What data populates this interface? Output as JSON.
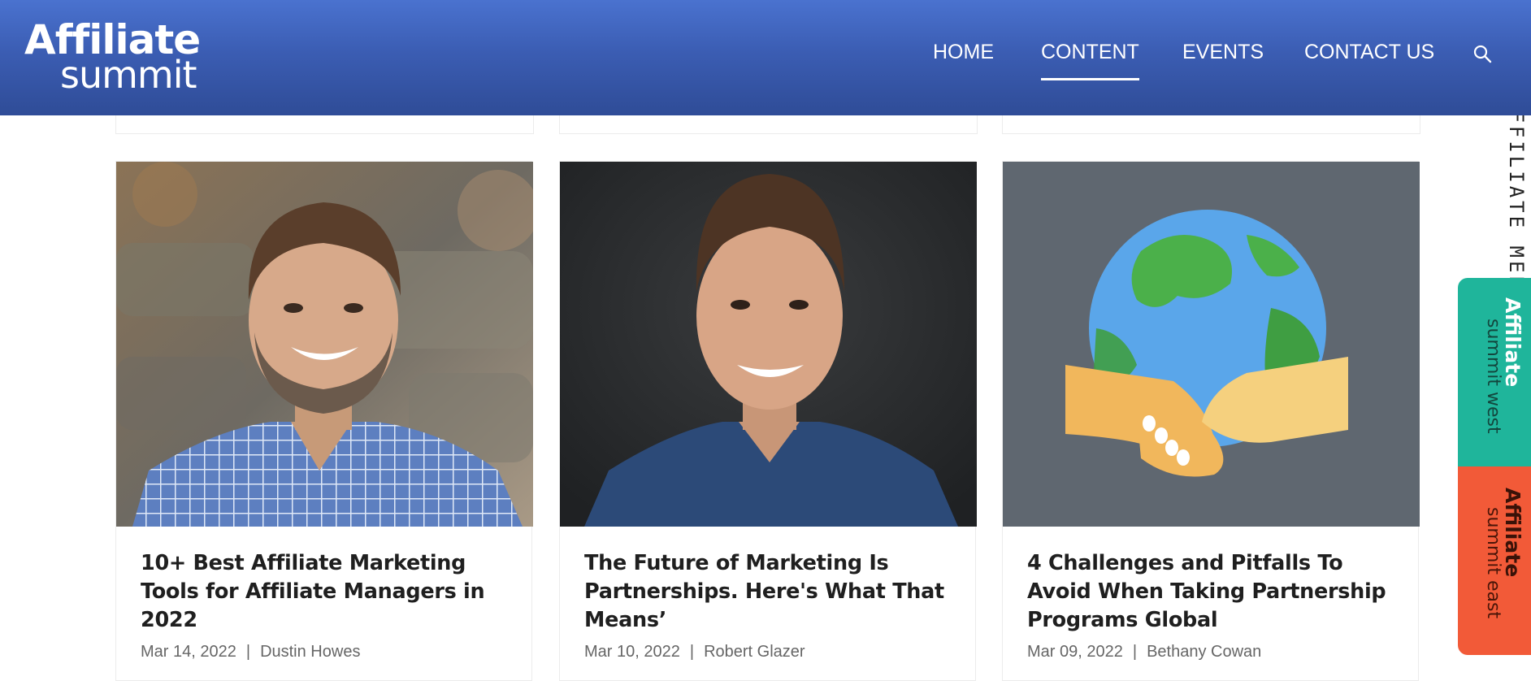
{
  "header": {
    "logo_top": "Affiliate",
    "logo_bottom": "summit",
    "nav": [
      "HOME",
      "CONTENT",
      "EVENTS",
      "CONTACT US"
    ],
    "active_nav": "CONTENT",
    "search_icon": "search-icon"
  },
  "articles": [
    {
      "title": "10+ Best Affiliate Marketing Tools for Affiliate Managers in 2022",
      "date": "Mar 14, 2022",
      "author": "Dustin Howes",
      "image": "portrait-man-plaid-shirt"
    },
    {
      "title": "The Future of Marketing Is Partnerships. Here's What That Means’",
      "date": "Mar 10, 2022",
      "author": "Robert Glazer",
      "image": "portrait-man-blue-shirt"
    },
    {
      "title": "4 Challenges and Pitfalls To Avoid When Taking Partnership Programs Global",
      "date": "Mar 09, 2022",
      "author": "Bethany Cowan",
      "image": "globe-handshake-illustration"
    }
  ],
  "meta_separator": "|",
  "side_tabs": {
    "meetmarket": "AFFILIATE MEET MARKT",
    "west_brand": "Affiliate",
    "west_sub": "summit west",
    "east_brand": "Affiliate",
    "east_sub": "summit east"
  },
  "colors": {
    "header_top": "#4a72cf",
    "header_bottom": "#2f4c97",
    "west_tab": "#1fb59b",
    "east_tab": "#f25a38"
  }
}
